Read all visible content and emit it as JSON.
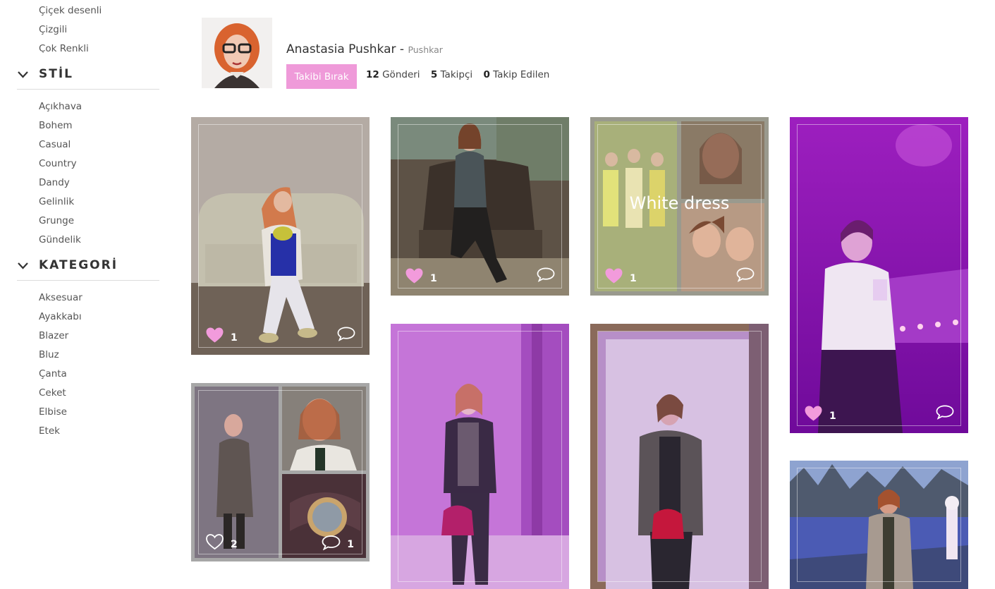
{
  "sidebar": {
    "pattern_items": [
      "Çiçek desenli",
      "Çizgili",
      "Çok Renkli"
    ],
    "style_section": {
      "title": "STİL",
      "items": [
        "Açıkhava",
        "Bohem",
        "Casual",
        "Country",
        "Dandy",
        "Gelinlik",
        "Grunge",
        "Gündelik"
      ]
    },
    "category_section": {
      "title": "KATEGORİ",
      "items": [
        "Aksesuar",
        "Ayakkabı",
        "Blazer",
        "Bluz",
        "Çanta",
        "Ceket",
        "Elbise",
        "Etek"
      ]
    }
  },
  "profile": {
    "name": "Anastasia Pushkar",
    "separator": " - ",
    "username": "Pushkar",
    "unfollow_label": "Takibi Bırak",
    "stats": {
      "posts_count": "12",
      "posts_label": "Gönderi",
      "followers_count": "5",
      "followers_label": "Takipçi",
      "following_count": "0",
      "following_label": "Takip Edilen"
    }
  },
  "posts": [
    {
      "likes": "1",
      "liked": true
    },
    {
      "likes": "1",
      "liked": true
    },
    {
      "likes": "1",
      "liked": true,
      "caption": "White dress"
    },
    {
      "likes": "1",
      "liked": true
    },
    {
      "likes": "2",
      "liked": false,
      "comments": "1"
    },
    {
      "liked": false
    },
    {
      "liked": false
    },
    {
      "liked": false
    }
  ],
  "colors": {
    "accent_pink": "#ef9ad9",
    "liked_heart": "#f29bdc",
    "overlay_purple": "#b000c8"
  },
  "icons": [
    "chevron-down-icon",
    "heart-icon",
    "comment-icon"
  ]
}
